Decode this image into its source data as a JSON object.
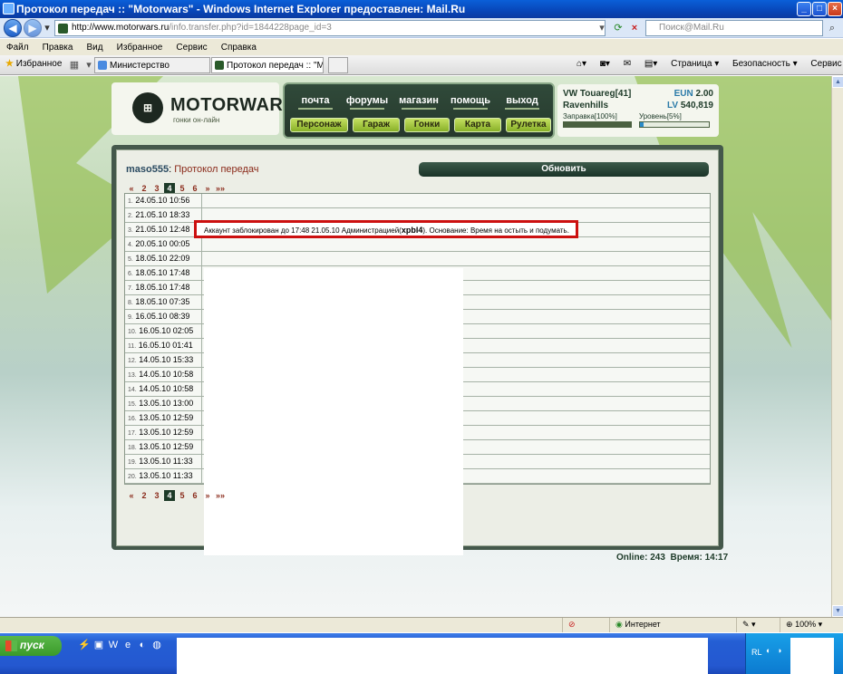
{
  "window": {
    "title": "Протокол передач :: \"Motorwars\" - Windows Internet Explorer предоставлен: Mail.Ru",
    "minimize": "_",
    "maximize": "□",
    "close": "×"
  },
  "browser": {
    "url_domain": "http://www.motorwars.ru",
    "url_path": "/info.transfer.php?id=1844228page_id=3",
    "search_placeholder": "Поиск@Mail.Ru",
    "menu": [
      "Файл",
      "Правка",
      "Вид",
      "Избранное",
      "Сервис",
      "Справка"
    ],
    "favorites_label": "Избранное",
    "tabs": [
      {
        "label": "Министерство",
        "active": false
      },
      {
        "label": "Протокол передач :: \"M...",
        "active": true
      }
    ],
    "tools": [
      "Страница ▾",
      "Безопасность ▾",
      "Сервис ▾"
    ],
    "status": {
      "zone": "Интернет",
      "zoom": "100%"
    }
  },
  "site": {
    "logo_text": "MOTORWARS.RU",
    "logo_sub": "гонки он-лайн",
    "top_nav": [
      "почта",
      "форумы",
      "магазин",
      "помощь",
      "выход"
    ],
    "main_nav": [
      "Персонаж",
      "Гараж",
      "Гонки",
      "Карта",
      "Рулетка"
    ],
    "car": {
      "name": "VW Touareg[41]",
      "city": "Ravenhills",
      "eun_label": "EUN",
      "eun": "2.00",
      "lv_label": "LV",
      "lv": "540,819",
      "fuel_label": "Заправка[100%]",
      "fuel_level": 1.0,
      "level_label": "Уровень[5%]",
      "level_progress": 0.05
    }
  },
  "page": {
    "user": "maso555",
    "title": "Протокол передач",
    "refresh_button": "Обновить",
    "pager": [
      "«",
      "2",
      "3",
      "4",
      "5",
      "6",
      "»",
      "»»"
    ],
    "current_page": "4",
    "rows": [
      {
        "num": "1.",
        "date": "24.05.10 10:56"
      },
      {
        "num": "2.",
        "date": "21.05.10 18:33"
      },
      {
        "num": "3.",
        "date": "21.05.10 12:48"
      },
      {
        "num": "4.",
        "date": "20.05.10 00:05"
      },
      {
        "num": "5.",
        "date": "18.05.10 22:09"
      },
      {
        "num": "6.",
        "date": "18.05.10 17:48"
      },
      {
        "num": "7.",
        "date": "18.05.10 17:48"
      },
      {
        "num": "8.",
        "date": "18.05.10 07:35"
      },
      {
        "num": "9.",
        "date": "16.05.10 08:39"
      },
      {
        "num": "10.",
        "date": "16.05.10 02:05"
      },
      {
        "num": "11.",
        "date": "16.05.10 01:41"
      },
      {
        "num": "12.",
        "date": "14.05.10 15:33"
      },
      {
        "num": "13.",
        "date": "14.05.10 10:58"
      },
      {
        "num": "14.",
        "date": "14.05.10 10:58"
      },
      {
        "num": "15.",
        "date": "13.05.10 13:00"
      },
      {
        "num": "16.",
        "date": "13.05.10 12:59"
      },
      {
        "num": "17.",
        "date": "13.05.10 12:59"
      },
      {
        "num": "18.",
        "date": "13.05.10 12:59"
      },
      {
        "num": "19.",
        "date": "13.05.10 11:33"
      },
      {
        "num": "20.",
        "date": "13.05.10 11:33"
      }
    ],
    "notice": {
      "prefix": "Аккаунт заблокирован до 17:48 21.05.10 Администрацией(",
      "admin": "xpbl4",
      "suffix": "). Основание: Время на остыть и подумать."
    },
    "online_label": "Online:",
    "online": "243",
    "time_label": "Время:",
    "time": "14:17"
  },
  "taskbar": {
    "start": "пуск",
    "lang": "RL"
  }
}
